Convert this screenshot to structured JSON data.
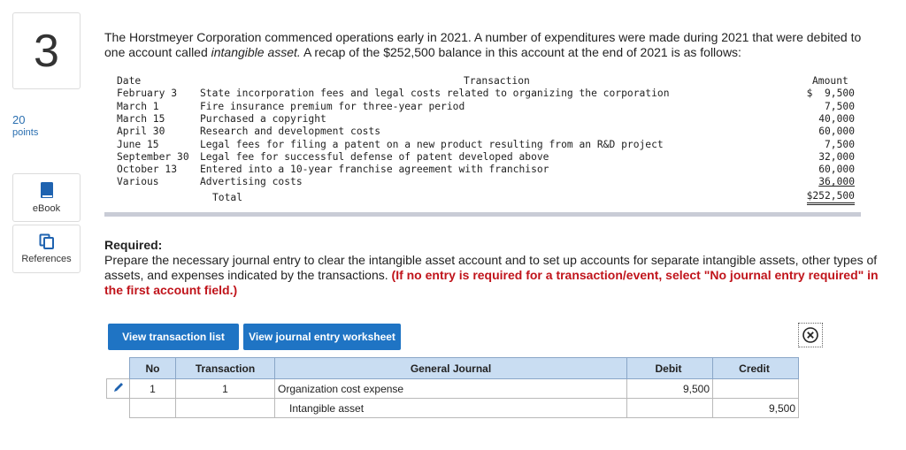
{
  "question": {
    "number": "3",
    "points_value": "20",
    "points_label": "points"
  },
  "sidebar": {
    "ebook_label": "eBook",
    "references_label": "References"
  },
  "intro": {
    "text_before": "The Horstmeyer Corporation commenced operations early in 2021. A number of expenditures were made during 2021 that were debited to one account called ",
    "italic_text": "intangible asset.",
    "text_after": " A recap of the $252,500 balance in this account at the end of 2021 is as follows:"
  },
  "recap": {
    "headers": {
      "date": "Date",
      "transaction": "Transaction",
      "amount": "Amount"
    },
    "rows": [
      {
        "date": "February 3",
        "transaction": "State incorporation fees and legal costs related to organizing the corporation",
        "amount": "$  9,500"
      },
      {
        "date": "March 1",
        "transaction": "Fire insurance premium for three-year period",
        "amount": "7,500"
      },
      {
        "date": "March 15",
        "transaction": "Purchased a copyright",
        "amount": "40,000"
      },
      {
        "date": "April 30",
        "transaction": "Research and development costs",
        "amount": "60,000"
      },
      {
        "date": "June 15",
        "transaction": "Legal fees for filing a patent on a new product resulting from an R&D project",
        "amount": "7,500"
      },
      {
        "date": "September 30",
        "transaction": "Legal fee for successful defense of patent developed above",
        "amount": "32,000"
      },
      {
        "date": "October 13",
        "transaction": "Entered into a 10-year franchise agreement with franchisor",
        "amount": "60,000"
      },
      {
        "date": "Various",
        "transaction": "Advertising costs",
        "amount": "36,000"
      }
    ],
    "total_label": "Total",
    "total_amount": "$252,500"
  },
  "required": {
    "heading": "Required:",
    "text": "Prepare the necessary journal entry to clear the intangible asset account and to set up accounts for separate intangible assets, other types of assets, and expenses indicated by the transactions. ",
    "red_text": "(If no entry is required for a transaction/event, select \"No journal entry required\" in the first account field.)"
  },
  "buttons": {
    "view_transaction_list": "View transaction list",
    "view_journal_entry_worksheet": "View journal entry worksheet"
  },
  "journal": {
    "headers": {
      "no": "No",
      "transaction": "Transaction",
      "general_journal": "General Journal",
      "debit": "Debit",
      "credit": "Credit"
    },
    "rows": [
      {
        "no": "1",
        "transaction": "1",
        "account": "Organization cost expense",
        "debit": "9,500",
        "credit": ""
      },
      {
        "no": "",
        "transaction": "",
        "account": "Intangible asset",
        "debit": "",
        "credit": "9,500"
      }
    ]
  },
  "colors": {
    "accent_blue": "#1f74c4",
    "required_red": "#c0141b",
    "table_header": "#c9ddf2"
  },
  "icons": {
    "ebook": "book-icon",
    "references": "copy-icon",
    "close": "close-circle-icon",
    "edit": "pencil-icon"
  }
}
